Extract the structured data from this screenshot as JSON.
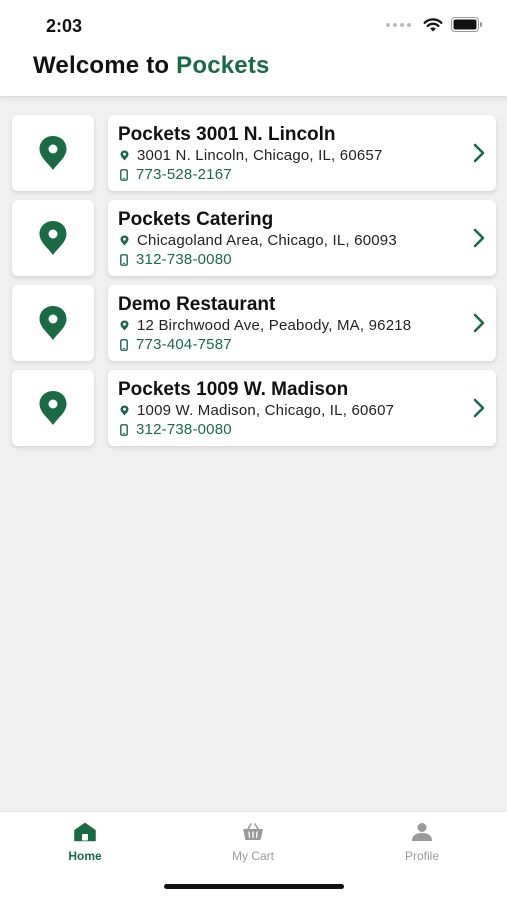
{
  "status_bar": {
    "time": "2:03"
  },
  "header": {
    "title_prefix": "Welcome to ",
    "title_brand": "Pockets"
  },
  "colors": {
    "brand_green": "#1a6b45",
    "background": "#f0f0f0"
  },
  "restaurants": [
    {
      "name": "Pockets 3001 N. Lincoln",
      "address": "3001 N. Lincoln, Chicago, IL, 60657",
      "phone": "773-528-2167"
    },
    {
      "name": "Pockets Catering",
      "address": "Chicagoland Area, Chicago, IL, 60093",
      "phone": "312-738-0080"
    },
    {
      "name": "Demo Restaurant",
      "address": "12 Birchwood Ave, Peabody, MA, 96218",
      "phone": "773-404-7587"
    },
    {
      "name": "Pockets 1009 W. Madison",
      "address": "1009 W. Madison, Chicago, IL, 60607",
      "phone": "312-738-0080"
    }
  ],
  "tabs": [
    {
      "label": "Home",
      "icon": "home-icon",
      "active": true
    },
    {
      "label": "My Cart",
      "icon": "basket-icon",
      "active": false
    },
    {
      "label": "Profile",
      "icon": "person-icon",
      "active": false
    }
  ]
}
